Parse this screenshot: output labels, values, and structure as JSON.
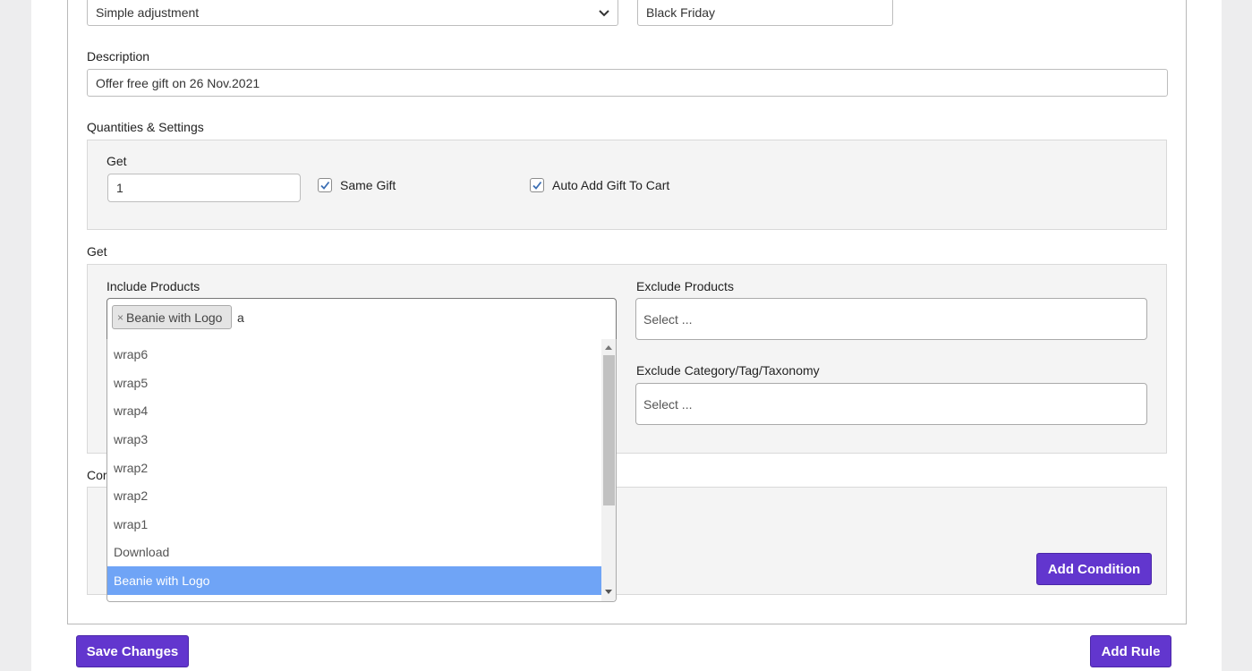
{
  "rule_type": {
    "value": "Simple adjustment"
  },
  "rule_title": {
    "value": "Black Friday"
  },
  "description": {
    "label": "Description",
    "value": "Offer free gift on 26 Nov.2021"
  },
  "quantities": {
    "section_label": "Quantities & Settings",
    "get_label": "Get",
    "get_value": "1",
    "same_gift": {
      "label": "Same Gift",
      "checked": true
    },
    "auto_add": {
      "label": "Auto Add Gift To Cart",
      "checked": true
    }
  },
  "get_section": {
    "label": "Get",
    "include_products": {
      "label": "Include Products",
      "tags": [
        {
          "remove": "×",
          "label": "Beanie with Logo"
        }
      ],
      "search_text": "a"
    },
    "exclude_products": {
      "label": "Exclude Products",
      "placeholder": "Select ..."
    },
    "exclude_taxonomy": {
      "label": "Exclude Category/Tag/Taxonomy",
      "placeholder": "Select ..."
    }
  },
  "dropdown_options": [
    "wrap6",
    "wrap5",
    "wrap4",
    "wrap3",
    "wrap2",
    "wrap2",
    "wrap1",
    "Download",
    "Beanie with Logo"
  ],
  "dropdown_highlighted_index": 8,
  "conditions": {
    "label_partial": "Cor",
    "add_button": "Add Condition"
  },
  "footer": {
    "save_button": "Save Changes",
    "add_rule_button": "Add Rule"
  },
  "colors": {
    "accent": "#6236ce",
    "highlight": "#6fa4f6",
    "panel": "#f4f4f4"
  }
}
